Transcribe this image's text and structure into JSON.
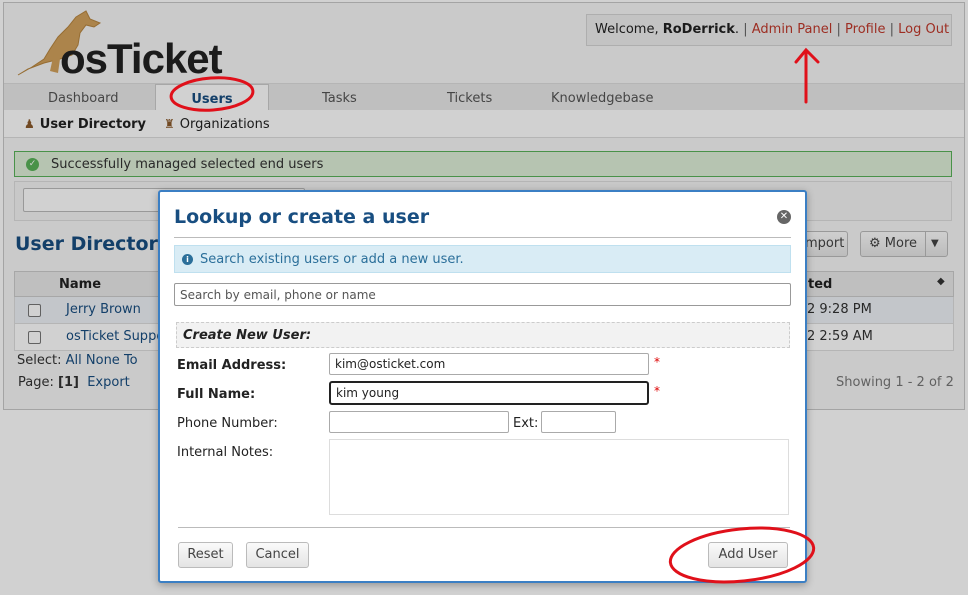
{
  "header": {
    "logo_text": "osTicket",
    "welcome_prefix": "Welcome, ",
    "username": "RoDerrick",
    "welcome_suffix": ".",
    "links": {
      "admin_panel": "Admin Panel",
      "profile": "Profile",
      "logout": "Log Out"
    },
    "separator": "|"
  },
  "nav": {
    "tabs": [
      {
        "label": "Dashboard"
      },
      {
        "label": "Users",
        "active": true
      },
      {
        "label": "Tasks"
      },
      {
        "label": "Tickets"
      },
      {
        "label": "Knowledgebase"
      }
    ]
  },
  "subnav": {
    "user_directory": "User Directory",
    "organizations": "Organizations"
  },
  "alert": {
    "success_text": "Successfully managed selected end users"
  },
  "page": {
    "section_title": "User Directory",
    "import_label": "mport",
    "more_label": "More",
    "table": {
      "col_name": "Name",
      "col_updated": "ted",
      "rows": [
        {
          "name": "Jerry Brown",
          "updated": "2 9:28 PM"
        },
        {
          "name": "osTicket Suppo",
          "updated": "2 2:59 AM"
        }
      ]
    },
    "select_row": {
      "label": "Select:",
      "all": "All",
      "none": "None",
      "toggle": "To"
    },
    "page_row": {
      "label": "Page:",
      "current": "[1]",
      "export": "Export"
    },
    "showing": "Showing 1 - 2 of 2"
  },
  "modal": {
    "title": "Lookup or create a user",
    "info_text": "Search existing users or add a new user.",
    "search_placeholder": "Search by email, phone or name",
    "create_header": "Create New User:",
    "email_label": "Email Address:",
    "email_value": "kim@osticket.com",
    "fullname_label": "Full Name:",
    "fullname_value": "kim young",
    "phone_label": "Phone Number:",
    "phone_value": "",
    "ext_label": "Ext:",
    "ext_value": "",
    "notes_label": "Internal Notes:",
    "required_mark": "*",
    "reset_label": "Reset",
    "cancel_label": "Cancel",
    "add_user_label": "Add User"
  },
  "colors": {
    "link_red": "#c0392b",
    "title_blue": "#184e81",
    "success_green": "#5ab35a",
    "info_bg": "#d9ecf5",
    "annotation_red": "#e0101a"
  },
  "icons": [
    "check-circle-icon",
    "users-icon",
    "building-icon",
    "info-icon",
    "close-icon",
    "gear-icon",
    "caret-down-icon",
    "sort-icon"
  ]
}
